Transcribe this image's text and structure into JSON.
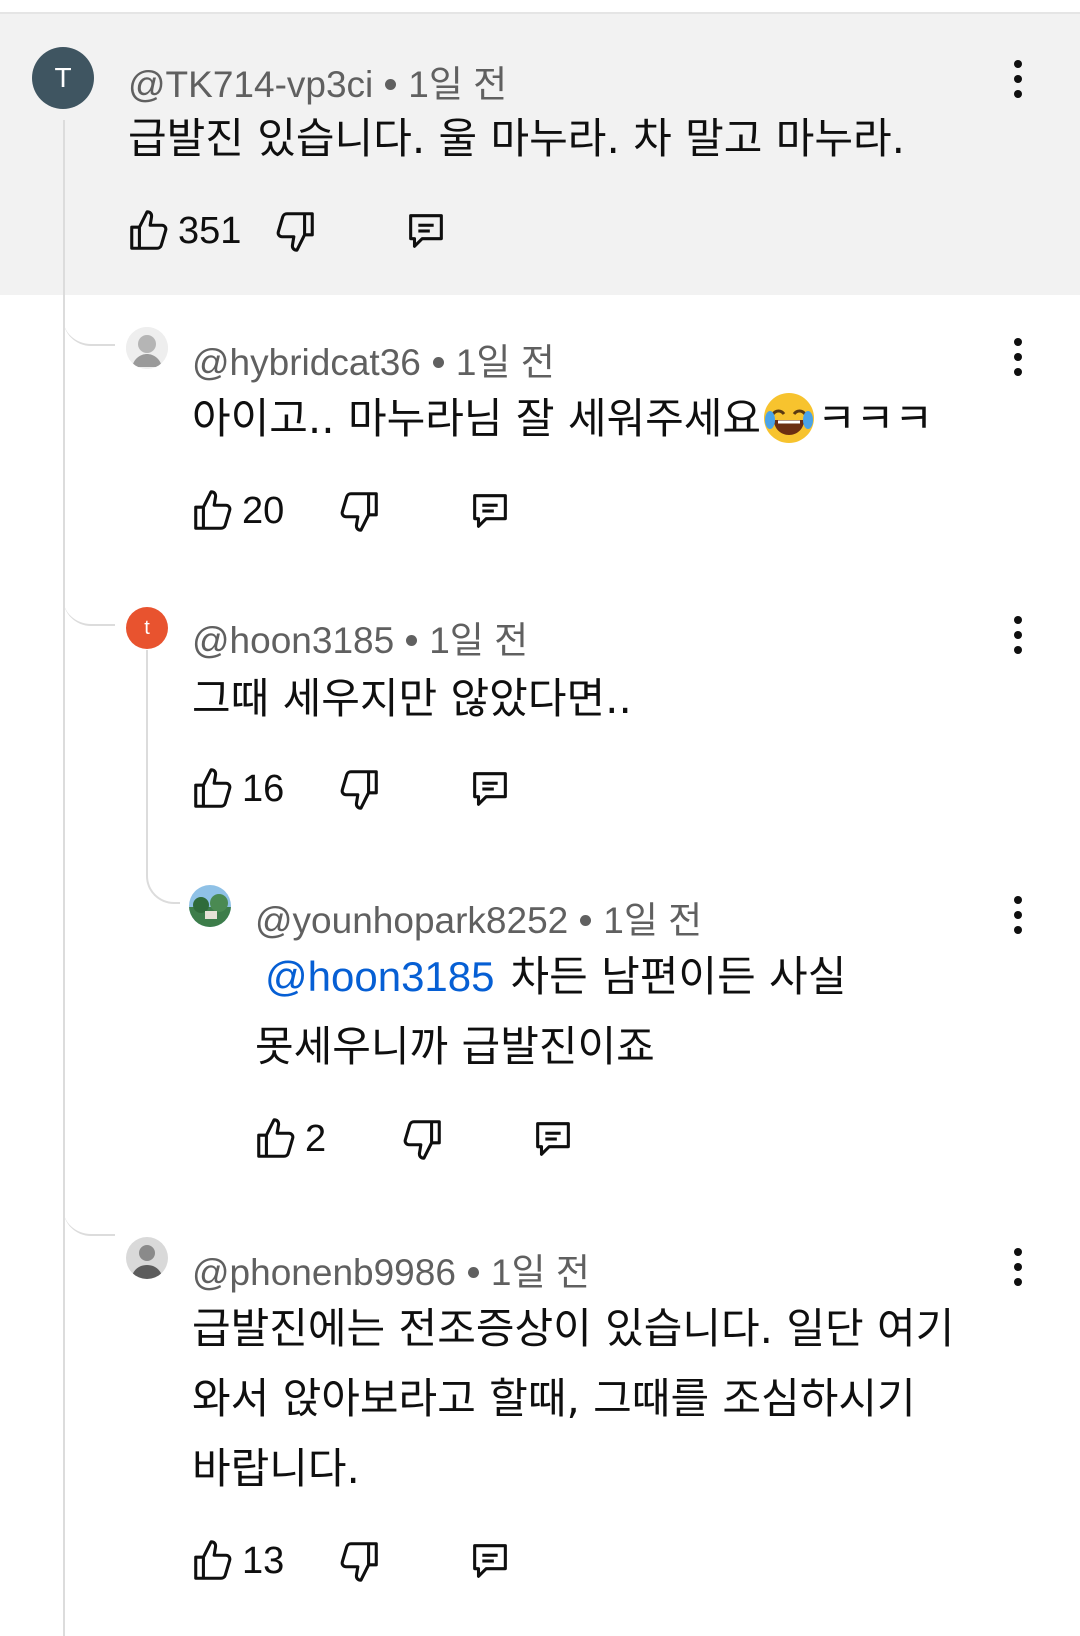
{
  "comments": [
    {
      "author": "@TK714-vp3ci",
      "avatar_letter": "T",
      "time": "1일 전",
      "text_lines": [
        "급발진 있습니다. 울 마누라. 차 말고 마누라."
      ],
      "likes": "351"
    },
    {
      "author": "@hybridcat36",
      "time": "1일 전",
      "text_lines": [
        "아이고.. 마누라님 잘 세워주세요",
        "ㅋㅋㅋ"
      ],
      "emoji": "tears-of-joy-emoji",
      "likes": "20"
    },
    {
      "author": "@hoon3185",
      "avatar_letter": "t",
      "time": "1일 전",
      "text_lines": [
        "그때 세우지만 않았다면.."
      ],
      "likes": "16"
    },
    {
      "author": "@younhopark8252",
      "time": "1일 전",
      "mention": "@hoon3185",
      "text_lines": [
        "차든 남편이든 사실",
        "못세우니까 급발진이죠"
      ],
      "likes": "2"
    },
    {
      "author": "@phonenb9986",
      "time": "1일 전",
      "text_lines": [
        "급발진에는 전조증상이 있습니다. 일단 여기",
        "와서 앉아보라고 할때, 그때를 조심하시기",
        "바랍니다."
      ],
      "likes": "13"
    }
  ],
  "icons": {
    "like": "thumbs-up-icon",
    "dislike": "thumbs-down-icon",
    "reply": "reply-comment-icon",
    "more": "more-vertical-icon"
  },
  "colors": {
    "highlight_bg": "#f2f2f2",
    "mention": "#065fd4",
    "meta_text": "#606060"
  }
}
